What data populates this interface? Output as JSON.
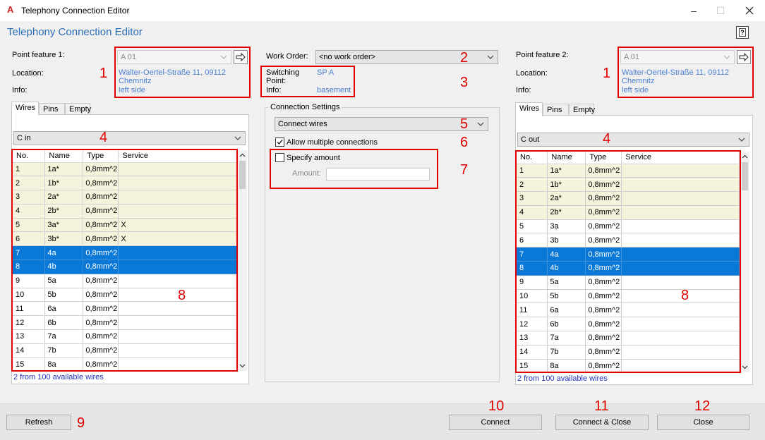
{
  "window": {
    "title": "Telephony Connection Editor"
  },
  "header": {
    "title": "Telephony Connection Editor",
    "help_label": "?"
  },
  "left": {
    "point_label": "Point feature 1:",
    "point_value": "A 01",
    "location_label": "Location:",
    "location_line1": "Walter-Oertel-Straße 11, 09112",
    "location_line2": "Chemnitz",
    "info_label": "Info:",
    "info_value": "left side",
    "tabs": [
      "Wires",
      "Pins",
      "Empty"
    ],
    "cable": "C in",
    "status": "2 from 100 available wires"
  },
  "right": {
    "point_label": "Point feature 2:",
    "point_value": "A 01",
    "location_label": "Location:",
    "location_line1": "Walter-Oertel-Straße 11, 09112",
    "location_line2": "Chemnitz",
    "info_label": "Info:",
    "info_value": "left side",
    "tabs": [
      "Wires",
      "Pins",
      "Empty"
    ],
    "cable": "C out",
    "status": "2 from 100 available wires"
  },
  "center": {
    "work_order_label": "Work Order:",
    "work_order_value": "<no work order>",
    "switching_point_label_1": "Switching",
    "switching_point_label_2": "Point:",
    "switching_point_value": "SP A",
    "info_label": "Info:",
    "info_value": "basement",
    "connection_settings_label": "Connection Settings",
    "mode_value": "Connect wires",
    "allow_multiple_label": "Allow multiple connections",
    "allow_multiple_checked": true,
    "specify_amount_label": "Specify amount",
    "specify_amount_checked": false,
    "amount_label": "Amount:",
    "amount_value": ""
  },
  "table": {
    "columns": [
      "No.",
      "Name",
      "Type",
      "Service"
    ],
    "left_rows": [
      [
        "1",
        "1a*",
        "0,8mm^2",
        ""
      ],
      [
        "2",
        "1b*",
        "0,8mm^2",
        ""
      ],
      [
        "3",
        "2a*",
        "0,8mm^2",
        ""
      ],
      [
        "4",
        "2b*",
        "0,8mm^2",
        ""
      ],
      [
        "5",
        "3a*",
        "0,8mm^2",
        "X"
      ],
      [
        "6",
        "3b*",
        "0,8mm^2",
        "X"
      ],
      [
        "7",
        "4a",
        "0,8mm^2",
        ""
      ],
      [
        "8",
        "4b",
        "0,8mm^2",
        ""
      ],
      [
        "9",
        "5a",
        "0,8mm^2",
        ""
      ],
      [
        "10",
        "5b",
        "0,8mm^2",
        ""
      ],
      [
        "11",
        "6a",
        "0,8mm^2",
        ""
      ],
      [
        "12",
        "6b",
        "0,8mm^2",
        ""
      ],
      [
        "13",
        "7a",
        "0,8mm^2",
        ""
      ],
      [
        "14",
        "7b",
        "0,8mm^2",
        ""
      ],
      [
        "15",
        "8a",
        "0,8mm^2",
        ""
      ]
    ],
    "right_rows": [
      [
        "1",
        "1a*",
        "0,8mm^2",
        ""
      ],
      [
        "2",
        "1b*",
        "0,8mm^2",
        ""
      ],
      [
        "3",
        "2a*",
        "0,8mm^2",
        ""
      ],
      [
        "4",
        "2b*",
        "0,8mm^2",
        ""
      ],
      [
        "5",
        "3a",
        "0,8mm^2",
        ""
      ],
      [
        "6",
        "3b",
        "0,8mm^2",
        ""
      ],
      [
        "7",
        "4a",
        "0,8mm^2",
        ""
      ],
      [
        "8",
        "4b",
        "0,8mm^2",
        ""
      ],
      [
        "9",
        "5a",
        "0,8mm^2",
        ""
      ],
      [
        "10",
        "5b",
        "0,8mm^2",
        ""
      ],
      [
        "11",
        "6a",
        "0,8mm^2",
        ""
      ],
      [
        "12",
        "6b",
        "0,8mm^2",
        ""
      ],
      [
        "13",
        "7a",
        "0,8mm^2",
        ""
      ],
      [
        "14",
        "7b",
        "0,8mm^2",
        ""
      ],
      [
        "15",
        "8a",
        "0,8mm^2",
        ""
      ]
    ],
    "left_used_rows": [
      1,
      2,
      3,
      4,
      5,
      6
    ],
    "right_used_rows": [
      1,
      2,
      3,
      4
    ],
    "selected_rows": [
      7,
      8
    ]
  },
  "buttons": {
    "refresh": "Refresh",
    "connect": "Connect",
    "connect_close": "Connect & Close",
    "close": "Close"
  },
  "annotations": {
    "n1": "1",
    "n2": "2",
    "n3": "3",
    "n4": "4",
    "n5": "5",
    "n6": "6",
    "n7": "7",
    "n8": "8",
    "n9": "9",
    "n10": "10",
    "n11": "11",
    "n12": "12"
  },
  "colors": {
    "accent": "#2a6db5",
    "link": "#4a7fcf",
    "annotation": "#e00000",
    "selection": "#0a78d7",
    "used_row": "#f5f3dc",
    "status": "#2233bb"
  }
}
